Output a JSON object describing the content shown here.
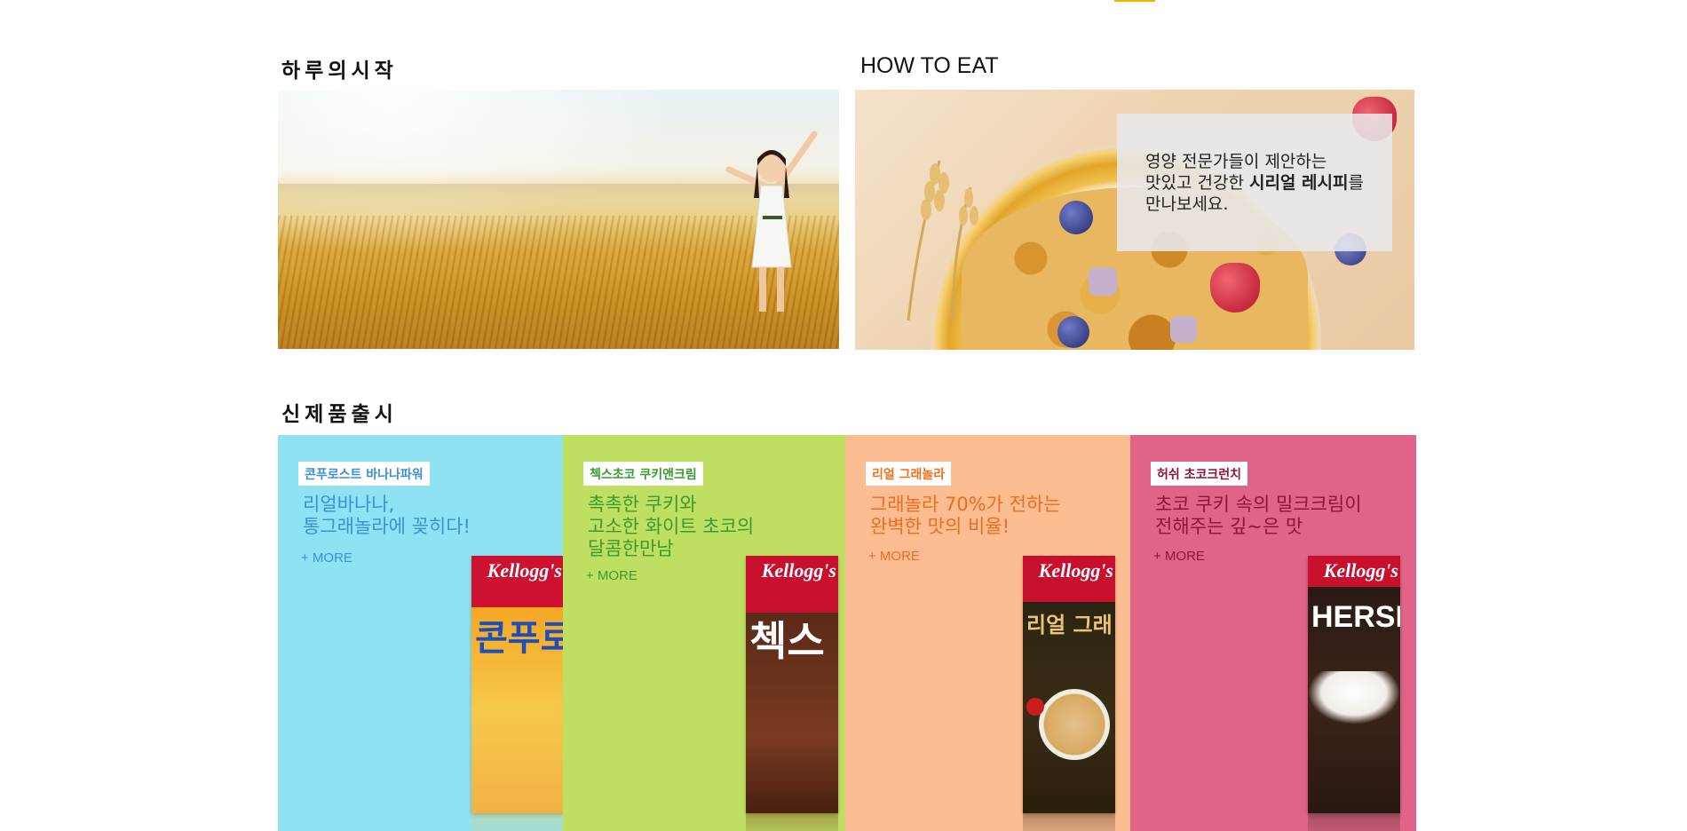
{
  "sections": {
    "start_title": "하루의시작",
    "howto_title": "HOW TO EAT",
    "new_title": "신제품출시"
  },
  "howto": {
    "line1": "영양 전문가들이 제안하는",
    "line2_pre": "맛있고 건강한 ",
    "line2_bold": "시리얼 레시피",
    "line2_post": "를",
    "line3": "만나보세요."
  },
  "products": [
    {
      "badge": "콘푸로스트 바나나파워",
      "headline": [
        "리얼바나나,",
        "통그래놀라에 꽂히다!"
      ],
      "more": "+ MORE",
      "box_brand": "Kellogg's",
      "box_name": "콘푸로스",
      "bg": "#8fe2f2",
      "color": "#3f8fd6"
    },
    {
      "badge": "첵스초코 쿠키앤크림",
      "headline": [
        "촉촉한 쿠키와",
        "고소한 화이트 초코의",
        "달콤한만남"
      ],
      "more": "+ MORE",
      "box_brand": "Kellogg's",
      "box_name": "첵스",
      "bg": "#bfdf63",
      "color": "#3a9a2f"
    },
    {
      "badge": "리얼 그래놀라",
      "headline": [
        "그래놀라 70%가 전하는",
        "완벽한 맛의 비율!"
      ],
      "more": "+ MORE",
      "box_brand": "Kellogg's",
      "box_name": "리얼 그래",
      "bg": "#fdbd92",
      "color": "#ef6d1e"
    },
    {
      "badge": "허쉬 초코크런치",
      "headline": [
        "초코 쿠키 속의 밀크크림이",
        "전해주는 깊~은 맛"
      ],
      "more": "+ MORE",
      "box_brand": "Kellogg's",
      "box_name": "HERSH",
      "bg": "#e06487",
      "color": "#8b1538"
    }
  ],
  "colors": {
    "accent_bar": "#e8b400"
  },
  "icons": [
    "child-in-wheat-field-image",
    "cereal-bowl-image",
    "cereal-box-image"
  ]
}
